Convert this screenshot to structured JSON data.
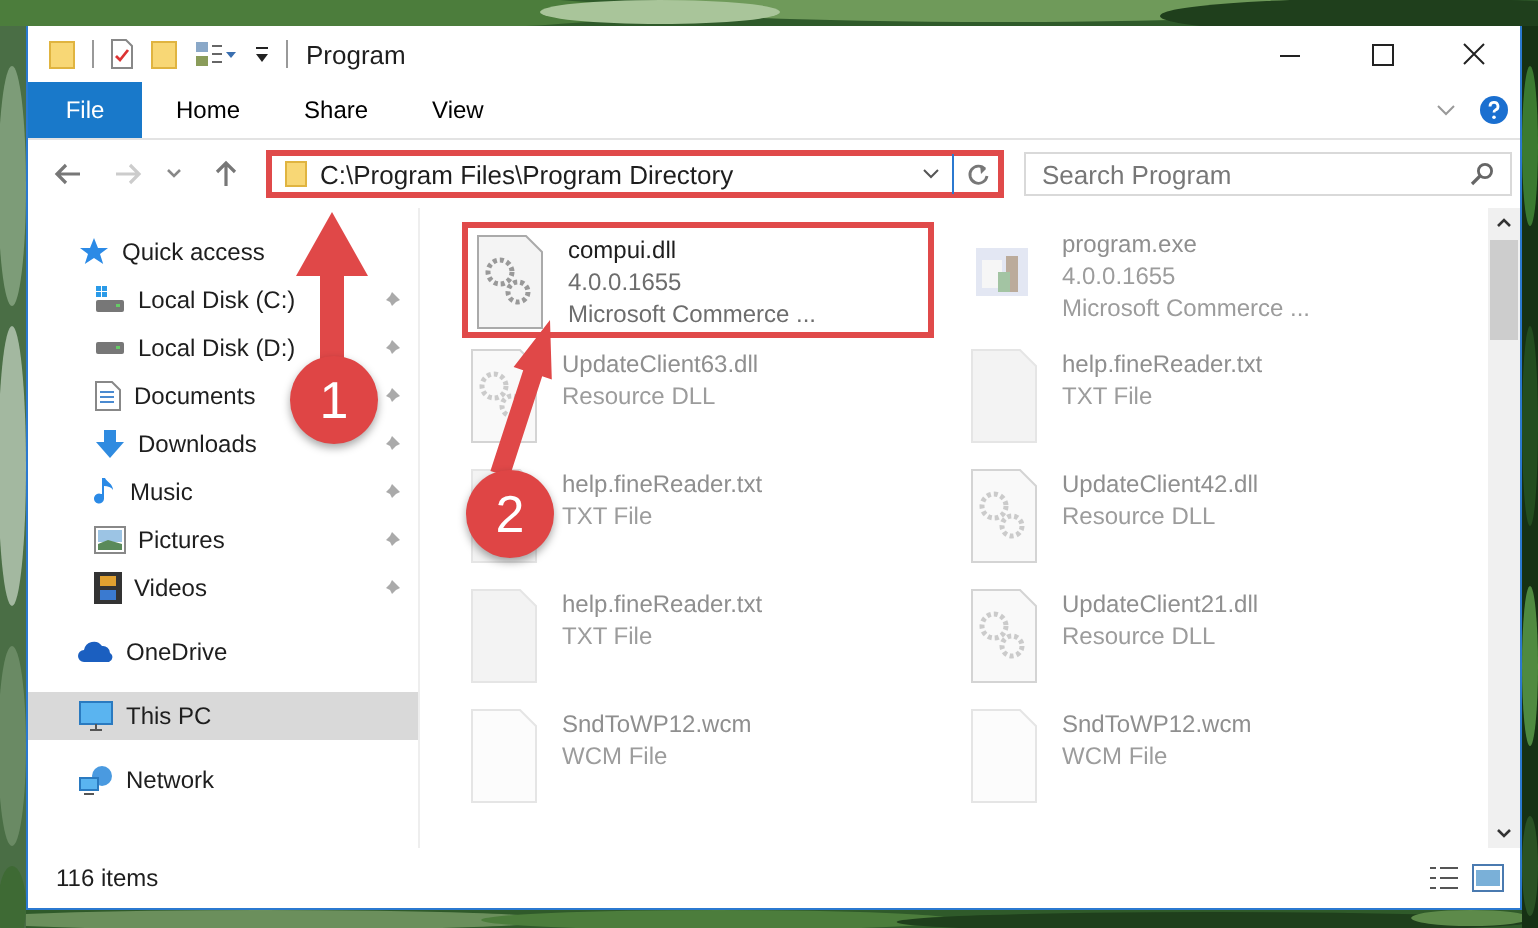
{
  "window": {
    "title": "Program"
  },
  "ribbon": {
    "file_button": "File",
    "tabs": [
      {
        "label": "Home",
        "selected": false
      },
      {
        "label": "Share",
        "selected": false
      },
      {
        "label": "View",
        "selected": false
      }
    ]
  },
  "address": {
    "path": "C:\\Program Files\\Program Directory",
    "highlighted": true
  },
  "search": {
    "placeholder": "Search Program"
  },
  "sidebar": {
    "items": [
      {
        "label": "Quick access",
        "kind": "quick",
        "selected": false,
        "children": [
          {
            "label": "Local Disk (C:)",
            "kind": "disk_c",
            "selected": false,
            "pinned": true
          },
          {
            "label": "Local Disk (D:)",
            "kind": "disk",
            "selected": false,
            "pinned": true
          },
          {
            "label": "Documents",
            "kind": "documents",
            "selected": false,
            "pinned": true
          },
          {
            "label": "Downloads",
            "kind": "downloads",
            "selected": false,
            "pinned": true
          },
          {
            "label": "Music",
            "kind": "music",
            "selected": false,
            "pinned": true
          },
          {
            "label": "Pictures",
            "kind": "pictures",
            "selected": false,
            "pinned": true
          },
          {
            "label": "Videos",
            "kind": "videos",
            "selected": false,
            "pinned": true
          }
        ]
      },
      {
        "label": "OneDrive",
        "kind": "onedrive",
        "selected": false
      },
      {
        "label": "This PC",
        "kind": "pc",
        "selected": true
      },
      {
        "label": "Network",
        "kind": "network",
        "selected": false
      }
    ]
  },
  "files": [
    {
      "name": "compui.dll",
      "lines": [
        "4.0.0.1655",
        "Microsoft Commerce ..."
      ],
      "kind": "dll",
      "faded": false,
      "highlighted": true
    },
    {
      "name": "program.exe",
      "lines": [
        "4.0.0.1655",
        "Microsoft Commerce ..."
      ],
      "kind": "exe",
      "faded": true,
      "highlighted": false
    },
    {
      "name": "UpdateClient63.dll",
      "lines": [
        "Resource DLL"
      ],
      "kind": "dll",
      "faded": true,
      "highlighted": false
    },
    {
      "name": "help.fineReader.txt",
      "lines": [
        "TXT File"
      ],
      "kind": "txt",
      "faded": true,
      "highlighted": false
    },
    {
      "name": "help.fineReader.txt",
      "lines": [
        "TXT File"
      ],
      "kind": "txt",
      "faded": true,
      "highlighted": false
    },
    {
      "name": "UpdateClient42.dll",
      "lines": [
        "Resource DLL"
      ],
      "kind": "dll",
      "faded": true,
      "highlighted": false
    },
    {
      "name": "help.fineReader.txt",
      "lines": [
        "TXT File"
      ],
      "kind": "txt",
      "faded": true,
      "highlighted": false
    },
    {
      "name": "UpdateClient21.dll",
      "lines": [
        "Resource DLL"
      ],
      "kind": "dll",
      "faded": true,
      "highlighted": false
    },
    {
      "name": "SndToWP12.wcm",
      "lines": [
        "WCM File"
      ],
      "kind": "wcm",
      "faded": true,
      "highlighted": false
    },
    {
      "name": "SndToWP12.wcm",
      "lines": [
        "WCM File"
      ],
      "kind": "wcm",
      "faded": true,
      "highlighted": false
    }
  ],
  "status_bar": {
    "count": "116 items"
  },
  "annotations": [
    {
      "number": "1"
    },
    {
      "number": "2"
    }
  ]
}
